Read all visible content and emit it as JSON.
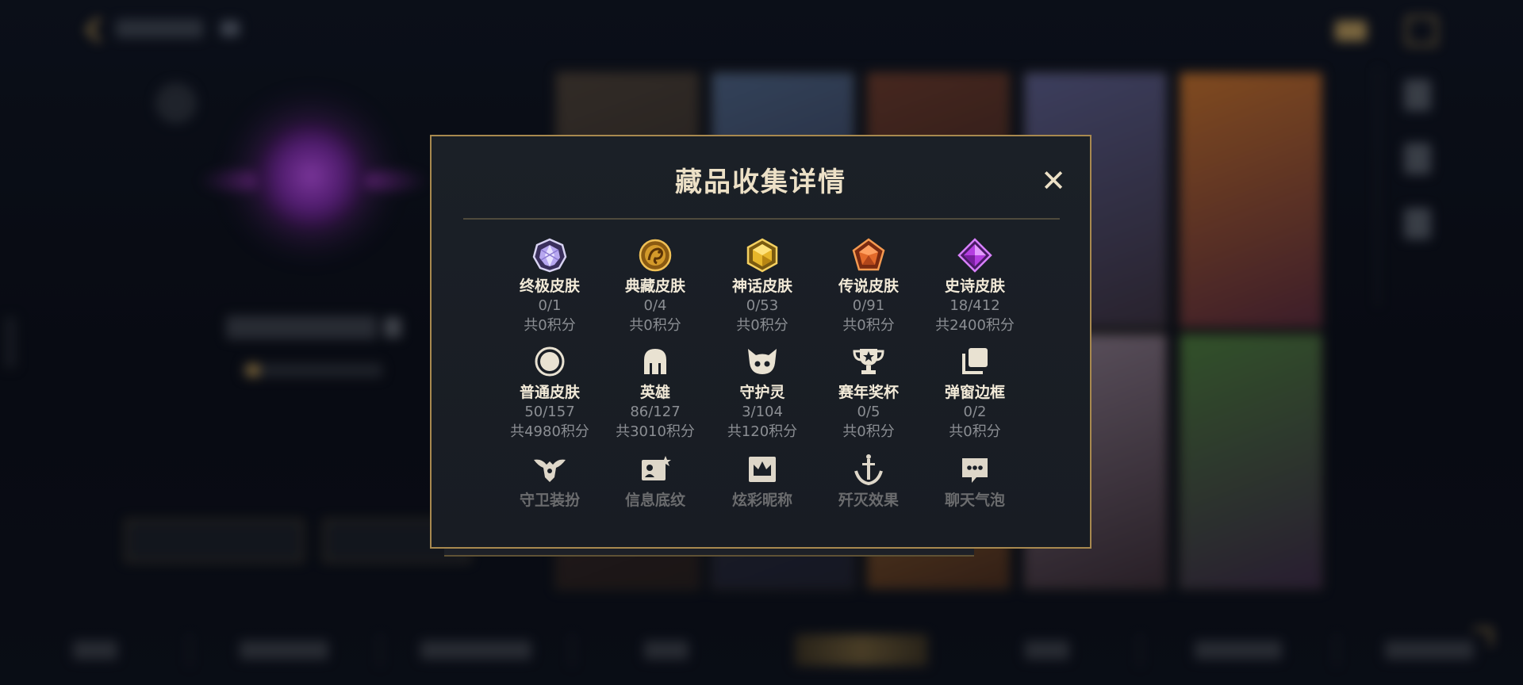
{
  "modal": {
    "title": "藏品收集详情",
    "close_label": "✕"
  },
  "categories": [
    {
      "label": "终极皮肤",
      "count": "0/1",
      "points": "共0积分",
      "icon": "ultimate-skin-gem-icon",
      "color": "#b7a7f0"
    },
    {
      "label": "典藏皮肤",
      "count": "0/4",
      "points": "共0积分",
      "icon": "collection-dragon-emblem-icon",
      "color": "#d49a2a"
    },
    {
      "label": "神话皮肤",
      "count": "0/53",
      "points": "共0积分",
      "icon": "mythic-gem-icon",
      "color": "#e7b62a"
    },
    {
      "label": "传说皮肤",
      "count": "0/91",
      "points": "共0积分",
      "icon": "legendary-gem-icon",
      "color": "#e36a2a"
    },
    {
      "label": "史诗皮肤",
      "count": "18/412",
      "points": "共2400积分",
      "icon": "epic-gem-icon",
      "color": "#b43ee0"
    },
    {
      "label": "普通皮肤",
      "count": "50/157",
      "points": "共4980积分",
      "icon": "normal-skin-circle-icon",
      "color": "#e9e2d2"
    },
    {
      "label": "英雄",
      "count": "86/127",
      "points": "共3010积分",
      "icon": "hero-helmet-icon",
      "color": "#e9e2d2"
    },
    {
      "label": "守护灵",
      "count": "3/104",
      "points": "共120积分",
      "icon": "guardian-spirit-icon",
      "color": "#e9e2d2"
    },
    {
      "label": "赛年奖杯",
      "count": "0/5",
      "points": "共0积分",
      "icon": "trophy-icon",
      "color": "#e9e2d2"
    },
    {
      "label": "弹窗边框",
      "count": "0/2",
      "points": "共0积分",
      "icon": "popup-frame-icon",
      "color": "#e9e2d2"
    },
    {
      "label": "守卫装扮",
      "icon": "ward-skin-icon",
      "color": "#e9e2d2"
    },
    {
      "label": "信息底纹",
      "icon": "info-card-icon",
      "color": "#e9e2d2"
    },
    {
      "label": "炫彩昵称",
      "icon": "colorful-nickname-icon",
      "color": "#e9e2d2"
    },
    {
      "label": "歼灭效果",
      "icon": "ace-effect-icon",
      "color": "#e9e2d2"
    },
    {
      "label": "聊天气泡",
      "icon": "chat-bubble-icon",
      "color": "#e9e2d2"
    }
  ],
  "colors": {
    "gold_border": "#a8894f",
    "title_text": "#ece0c6",
    "muted_text": "#8b8e93",
    "panel_bg": "#1b2027"
  }
}
